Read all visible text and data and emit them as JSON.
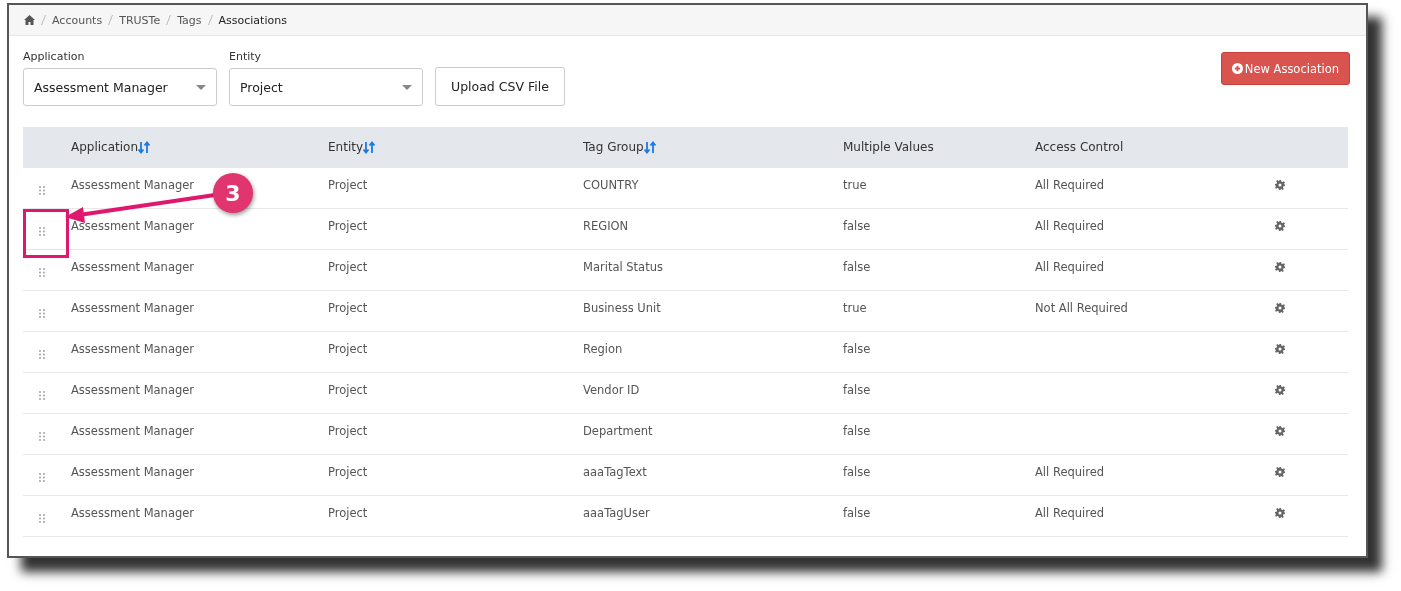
{
  "breadcrumb": [
    "Accounts",
    "TRUSTe",
    "Tags",
    "Associations"
  ],
  "filters": [
    {
      "label": "Application",
      "value": "Assessment Manager"
    },
    {
      "label": "Entity",
      "value": "Project"
    }
  ],
  "upload_button": "Upload CSV File",
  "new_button": "New Association",
  "table": {
    "columns": [
      {
        "label": "Application",
        "sortable": true
      },
      {
        "label": "Entity",
        "sortable": true
      },
      {
        "label": "Tag Group",
        "sortable": true
      },
      {
        "label": "Multiple Values",
        "sortable": false
      },
      {
        "label": "Access Control",
        "sortable": false
      }
    ],
    "rows": [
      [
        "Assessment Manager",
        "Project",
        "COUNTRY",
        "true",
        "All Required"
      ],
      [
        "Assessment Manager",
        "Project",
        "REGION",
        "false",
        "All Required"
      ],
      [
        "Assessment Manager",
        "Project",
        "Marital Status",
        "false",
        "All Required"
      ],
      [
        "Assessment Manager",
        "Project",
        "Business Unit",
        "true",
        "Not All Required"
      ],
      [
        "Assessment Manager",
        "Project",
        "Region",
        "false",
        ""
      ],
      [
        "Assessment Manager",
        "Project",
        "Vendor ID",
        "false",
        ""
      ],
      [
        "Assessment Manager",
        "Project",
        "Department",
        "false",
        ""
      ],
      [
        "Assessment Manager",
        "Project",
        "aaaTagText",
        "false",
        "All Required"
      ],
      [
        "Assessment Manager",
        "Project",
        "aaaTagUser",
        "false",
        "All Required"
      ]
    ]
  },
  "callout": {
    "label": "3"
  }
}
